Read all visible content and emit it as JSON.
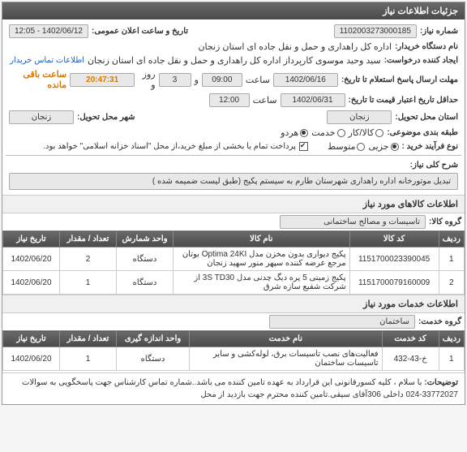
{
  "header": {
    "title": "جزئیات اطلاعات نیاز"
  },
  "f": {
    "need_no_label": "شماره نیاز:",
    "need_no": "1102003273000185",
    "announce_label": "تاریخ و ساعت اعلان عمومی:",
    "announce": "1402/06/12 - 12:05",
    "buyer_org_label": "نام دستگاه خریدار:",
    "buyer_org": "اداره کل راهداری و حمل و نقل جاده ای استان زنجان",
    "requester_label": "ایجاد کننده درخواست:",
    "requester": "سید وحید موسوی کارپرداز اداره کل راهداری و حمل و نقل جاده ای استان زنجان",
    "contact_link": "اطلاعات تماس خریدار",
    "deadline_label": "مهلت ارسال پاسخ استعلام تا تاریخ:",
    "deadline_date": "1402/06/16",
    "hour_label": "ساعت",
    "deadline_time": "09:00",
    "days_sep": "و",
    "days": "3",
    "days_suffix": "روز و",
    "countdown": "20:47:31",
    "countdown_suffix": "ساعت باقی مانده",
    "validity_label": "حداقل تاریخ اعتبار قیمت تا تاریخ:",
    "validity_date": "1402/06/31",
    "validity_time": "12:00",
    "prov_label": "استان محل تحویل:",
    "prov": "زنجان",
    "city_label": "شهر محل تحویل:",
    "city": "زنجان",
    "cat_label": "طبقه بندی موضوعی:",
    "cat_goods": "کالا/کار",
    "cat_service": "خدمت",
    "cat_both": "هردو",
    "proc_label": "نوع فرآیند خرید :",
    "proc_part": "جزیی",
    "proc_mid": "متوسط",
    "pay_note": "پرداخت تمام یا بخشی از مبلغ خرید،از محل \"اسناد خزانه اسلامی\" خواهد بود.",
    "desc_label": "شرح کلی نیاز:",
    "desc": "تبدیل موتورخانه اداره راهداری شهرستان طارم به سیستم پکیج (طبق لیست ضمیمه شده )"
  },
  "goods": {
    "section": "اطلاعات کالاهای مورد نیاز",
    "group_label": "گروه کالا:",
    "group": "تاسیسات و مصالح ساختمانی",
    "h": {
      "row": "ردیف",
      "code": "کد کالا",
      "name": "نام کالا",
      "unit": "واحد شمارش",
      "qty": "تعداد / مقدار",
      "date": "تاریخ نیاز"
    },
    "rows": [
      {
        "n": "1",
        "code": "1151700023390045",
        "name": "پکیج دیواری بدون مخزن مدل Optima 24KI بوتان مرجع عرضه کننده سپهر منور سهید زنجان",
        "unit": "دستگاه",
        "qty": "2",
        "date": "1402/06/20"
      },
      {
        "n": "2",
        "code": "1151700079160009",
        "name": "پکیج زمینی 5 پره دیگ چدنی مدل 3S TD30 از شرکت شفیع سازه شرق",
        "unit": "دستگاه",
        "qty": "1",
        "date": "1402/06/20"
      }
    ]
  },
  "services": {
    "section": "اطلاعات خدمات مورد نیاز",
    "group_label": "گروه خدمت:",
    "group": "ساختمان",
    "h": {
      "row": "ردیف",
      "code": "کد خدمت",
      "name": "نام خدمت",
      "unit": "واحد اندازه گیری",
      "qty": "تعداد / مقدار",
      "date": "تاریخ نیاز"
    },
    "rows": [
      {
        "n": "1",
        "code": "خ-43-432",
        "name": "فعالیت‌های نصب تاسیسات برق، لوله‌کشی و سایر تاسیسات ساختمان",
        "unit": "دستگاه",
        "qty": "1",
        "date": "1402/06/20"
      }
    ]
  },
  "footer": {
    "adv_label": "توضیحات:",
    "adv": "با سلام ، کلیه کسورقانونی این قرارداد به عهده تامین کننده می باشد..شماره تماس کارشناس جهت پاسخگویی به سوالات 33772027-024 داخلی 306آقای سیفی.تامین کننده محترم جهت بازدید از محل"
  }
}
